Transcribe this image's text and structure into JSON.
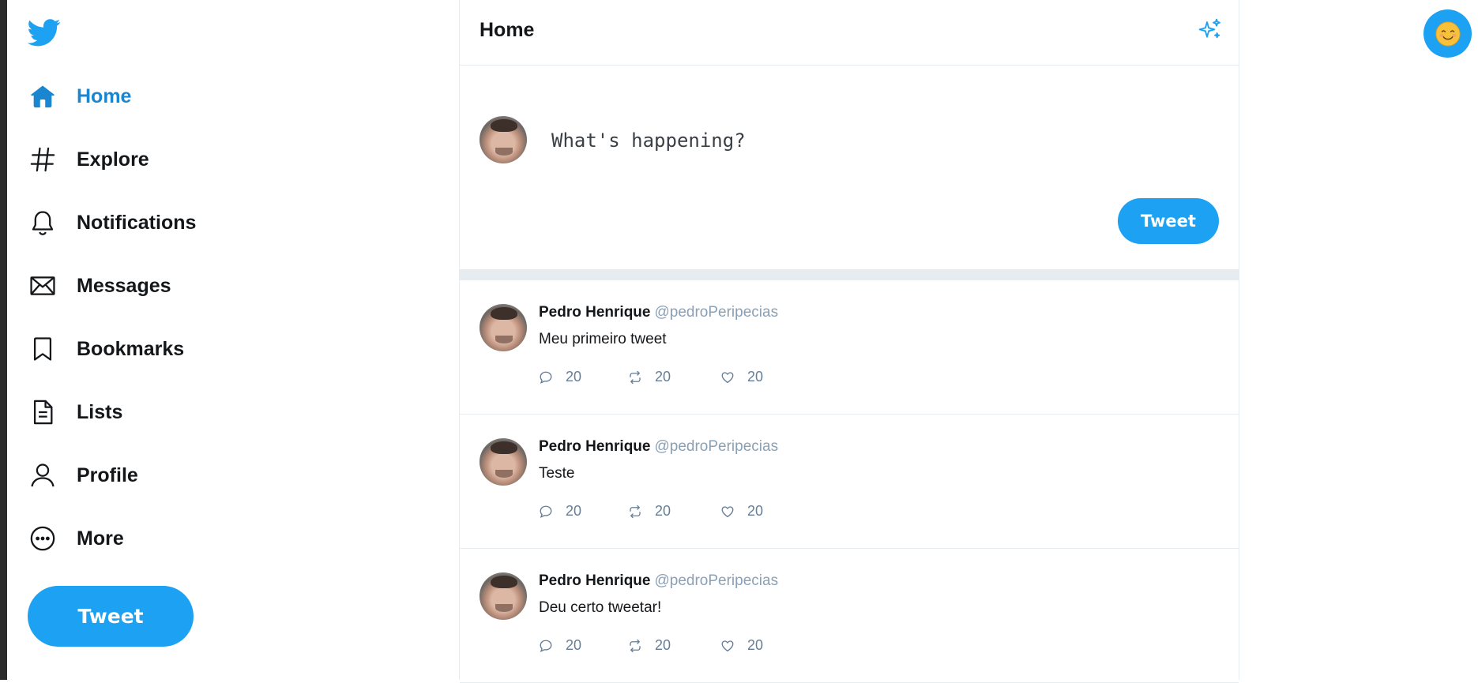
{
  "sidebar": {
    "logo_icon": "twitter-bird-icon",
    "items": [
      {
        "label": "Home",
        "icon": "home-icon",
        "active": true
      },
      {
        "label": "Explore",
        "icon": "hashtag-icon"
      },
      {
        "label": "Notifications",
        "icon": "bell-icon"
      },
      {
        "label": "Messages",
        "icon": "envelope-icon"
      },
      {
        "label": "Bookmarks",
        "icon": "bookmark-icon"
      },
      {
        "label": "Lists",
        "icon": "list-document-icon"
      },
      {
        "label": "Profile",
        "icon": "person-icon"
      },
      {
        "label": "More",
        "icon": "more-circle-icon"
      }
    ],
    "tweet_button": "Tweet"
  },
  "header": {
    "title": "Home",
    "sparkle_icon": "sparkle-icon"
  },
  "composer": {
    "placeholder": "What's happening?",
    "value": "",
    "tweet_button": "Tweet"
  },
  "tweets": [
    {
      "name": "Pedro Henrique",
      "handle": "@pedroPeripecias",
      "text": "Meu primeiro tweet",
      "replies": "20",
      "retweets": "20",
      "likes": "20"
    },
    {
      "name": "Pedro Henrique",
      "handle": "@pedroPeripecias",
      "text": "Teste",
      "replies": "20",
      "retweets": "20",
      "likes": "20"
    },
    {
      "name": "Pedro Henrique",
      "handle": "@pedroPeripecias",
      "text": "Deu certo tweetar!",
      "replies": "20",
      "retweets": "20",
      "likes": "20"
    }
  ],
  "colors": {
    "accent": "#1da1f2",
    "active_nav": "#1a86d0",
    "handle": "#8aa0b5",
    "border": "#e6ecf0"
  },
  "top_right": {
    "avatar_icon": "smiling-face-emoji-icon"
  }
}
